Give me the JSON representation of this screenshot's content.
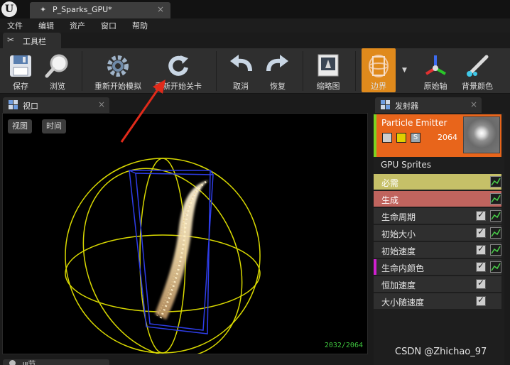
{
  "window": {
    "logo_letter": "U",
    "document_tab": {
      "label": "P_Sparks_GPU*",
      "close": "×"
    }
  },
  "menu": [
    "文件",
    "编辑",
    "资产",
    "窗口",
    "帮助"
  ],
  "toolbar": {
    "tab_label": "工具栏",
    "buttons": [
      {
        "label": "保存",
        "icon": "floppy-disk-icon"
      },
      {
        "label": "浏览",
        "icon": "magnifier-icon"
      },
      {
        "label": "重新开始模拟",
        "icon": "gear-icon"
      },
      {
        "label": "重新开始关卡",
        "icon": "restart-arrow-icon"
      },
      {
        "label": "取消",
        "icon": "undo-icon"
      },
      {
        "label": "恢复",
        "icon": "redo-icon"
      },
      {
        "label": "缩略图",
        "icon": "thumbnail-icon"
      },
      {
        "label": "边界",
        "icon": "bounds-icon",
        "active": true
      },
      {
        "label": "原始轴",
        "icon": "origin-axis-icon"
      },
      {
        "label": "背景颜色",
        "icon": "background-color-icon"
      }
    ],
    "accent_color": "#e08a1c"
  },
  "viewport": {
    "tab_label": "视口",
    "view_button": "视图",
    "time_button": "时间",
    "particle_counter": "2032/2064"
  },
  "bottom_panel": {
    "tab_label": "ψ节"
  },
  "emitters": {
    "tab_label": "发射器",
    "emitter": {
      "name": "Particle Emitter",
      "particle_count": "2064",
      "solo_label": "S"
    },
    "subtitle": "GPU Sprites",
    "modules": [
      {
        "label": "必需",
        "checkbox": false,
        "curve": true,
        "color": "#c9c46a"
      },
      {
        "label": "生成",
        "checkbox": false,
        "curve": true,
        "color": "#c86a6a"
      },
      {
        "label": "生命周期",
        "checkbox": true,
        "curve": true
      },
      {
        "label": "初始大小",
        "checkbox": true,
        "curve": true
      },
      {
        "label": "初始速度",
        "checkbox": true,
        "curve": true
      },
      {
        "label": "生命内颜色",
        "checkbox": true,
        "curve": true,
        "marker_color": "#d020d0"
      },
      {
        "label": "恒加速度",
        "checkbox": true,
        "curve": false
      },
      {
        "label": "大小随速度",
        "checkbox": true,
        "curve": false
      }
    ]
  },
  "watermark": "CSDN @Zhichao_97"
}
